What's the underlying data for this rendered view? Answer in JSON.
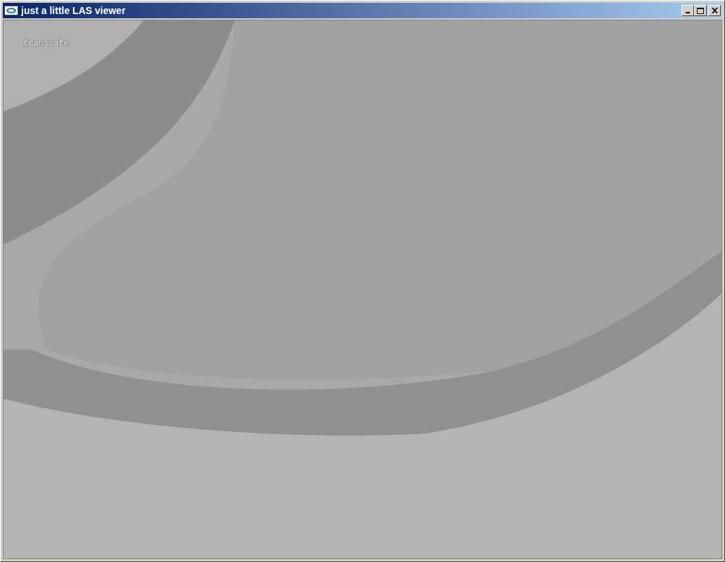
{
  "window": {
    "title": "just a little LAS viewer"
  },
  "viewport": {
    "mode_label": "translate"
  }
}
